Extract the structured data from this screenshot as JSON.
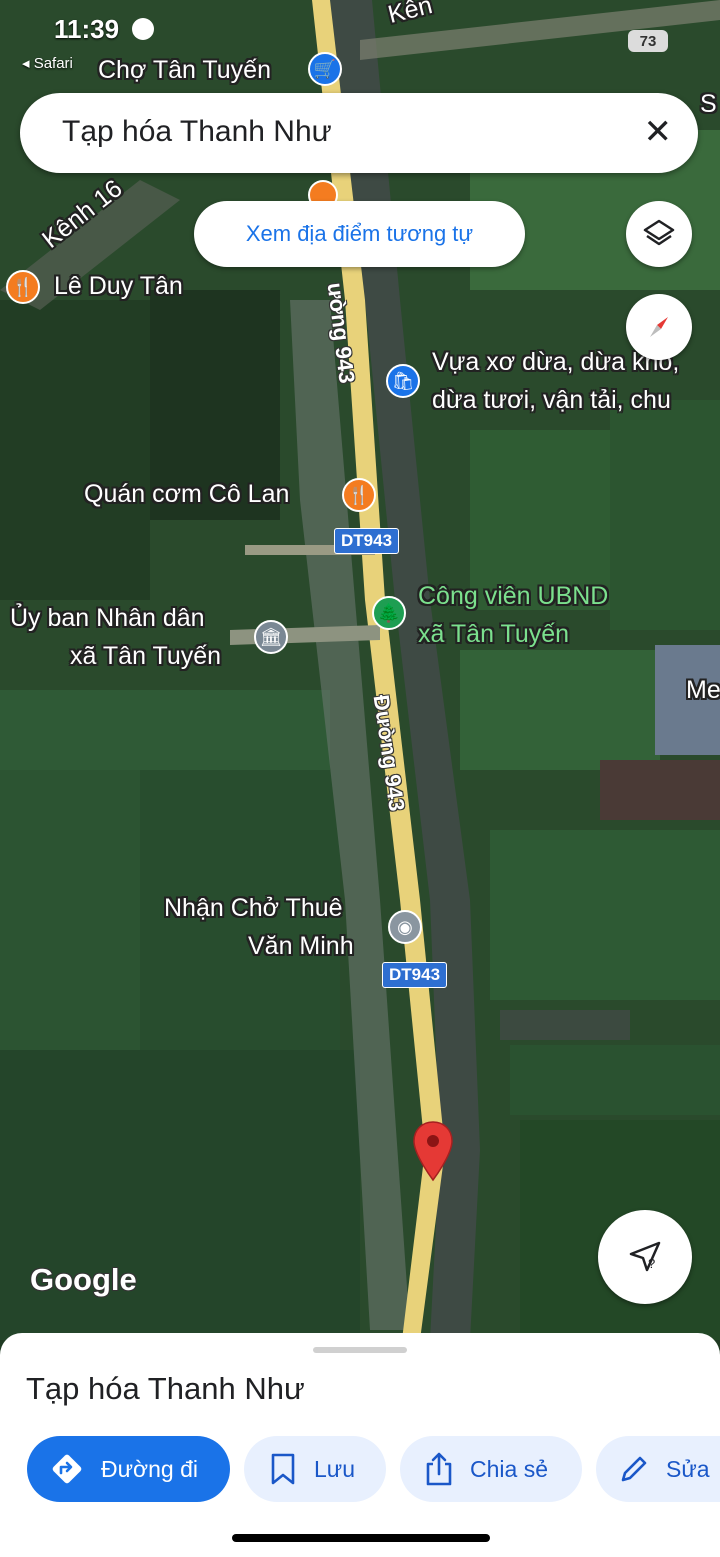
{
  "status_bar": {
    "time": "11:39",
    "back_app": "◂ Safari",
    "battery": "73"
  },
  "search": {
    "query": "Tạp hóa Thanh Như",
    "close_icon": "close-icon"
  },
  "similar_places_button": "Xem địa điểm tương tự",
  "map": {
    "labels": {
      "cho_tan_tuyen": "Chợ Tân Tuyến",
      "kenh16": "Kênh 16",
      "kenh_top": "Kên",
      "le_duy_tan": "Lê Duy Tân",
      "vua_xo_dua_1": "Vựa xơ dừa, dừa khô,",
      "vua_xo_dua_2": "dừa tươi, vận tải, chu",
      "quan_com": "Quán cơm Cô Lan",
      "cong_vien_1": "Công viên UBND",
      "cong_vien_2": "xã Tân Tuyến",
      "uy_ban_1": "Ủy ban Nhân dân",
      "uy_ban_2": "xã Tân Tuyến",
      "nhan_cho_1": "Nhận Chở Thuê",
      "nhan_cho_2": "Văn Minh",
      "edge_s": "S",
      "edge_me": "Me"
    },
    "roads": {
      "upper": "ường 943",
      "lower": "Đường 943"
    },
    "shields": {
      "a": "DT943",
      "b": "DT943"
    },
    "google_logo": "Google"
  },
  "colors": {
    "accent": "#1a73e8",
    "pin_red": "#e53935",
    "poi_orange": "#f47c20",
    "road_yellow": "#e8d27a"
  },
  "bottom_sheet": {
    "title": "Tạp hóa Thanh Như",
    "actions": {
      "directions": "Đường đi",
      "save": "Lưu",
      "share": "Chia sẻ",
      "edit": "Sửa"
    }
  }
}
